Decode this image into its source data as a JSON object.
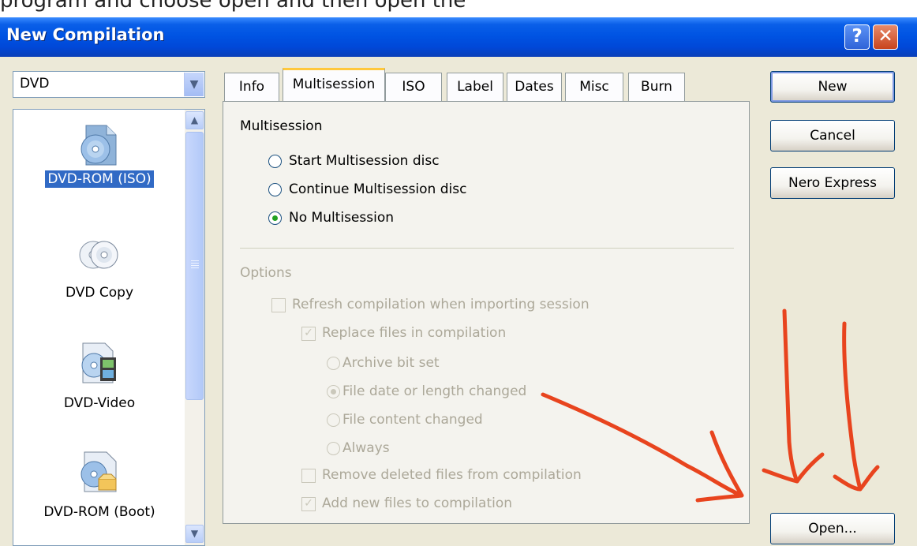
{
  "top_strip": {
    "text": "program and choose open and then open the"
  },
  "window": {
    "title": "New Compilation"
  },
  "titlebar": {
    "help_glyph": "?",
    "close_glyph": "✕"
  },
  "combo": {
    "value": "DVD"
  },
  "list": {
    "items": [
      {
        "label": "DVD-ROM (ISO)",
        "icon": "dvd-rom-iso-icon",
        "selected": true
      },
      {
        "label": "DVD Copy",
        "icon": "dvd-copy-icon",
        "selected": false
      },
      {
        "label": "DVD-Video",
        "icon": "dvd-video-icon",
        "selected": false
      },
      {
        "label": "DVD-ROM (Boot)",
        "icon": "dvd-rom-boot-icon",
        "selected": false
      }
    ]
  },
  "tabs": [
    {
      "label": "Info",
      "active": false
    },
    {
      "label": "Multisession",
      "active": true
    },
    {
      "label": "ISO",
      "active": false
    },
    {
      "label": "Label",
      "active": false
    },
    {
      "label": "Dates",
      "active": false
    },
    {
      "label": "Misc",
      "active": false
    },
    {
      "label": "Burn",
      "active": false
    }
  ],
  "multisession": {
    "heading": "Multisession",
    "options": [
      {
        "label": "Start Multisession disc",
        "selected": false
      },
      {
        "label": "Continue Multisession disc",
        "selected": false
      },
      {
        "label": "No Multisession",
        "selected": true
      }
    ]
  },
  "options": {
    "heading": "Options",
    "refresh": {
      "label": "Refresh compilation when importing session",
      "checked": false
    },
    "replace": {
      "label": "Replace files in compilation",
      "checked": true
    },
    "replace_modes": [
      {
        "label": "Archive bit set",
        "selected": false
      },
      {
        "label": "File date or length changed",
        "selected": true
      },
      {
        "label": "File content changed",
        "selected": false
      },
      {
        "label": "Always",
        "selected": false
      }
    ],
    "remove_deleted": {
      "label": "Remove deleted files from compilation",
      "checked": false
    },
    "add_new": {
      "label": "Add new files to compilation",
      "checked": true
    }
  },
  "buttons": {
    "new": "New",
    "cancel": "Cancel",
    "nero_express": "Nero Express",
    "open": "Open..."
  },
  "colors": {
    "annotation": "#e8441e",
    "titlebar": "#0054e3",
    "dialog_bg": "#ece9d8"
  }
}
